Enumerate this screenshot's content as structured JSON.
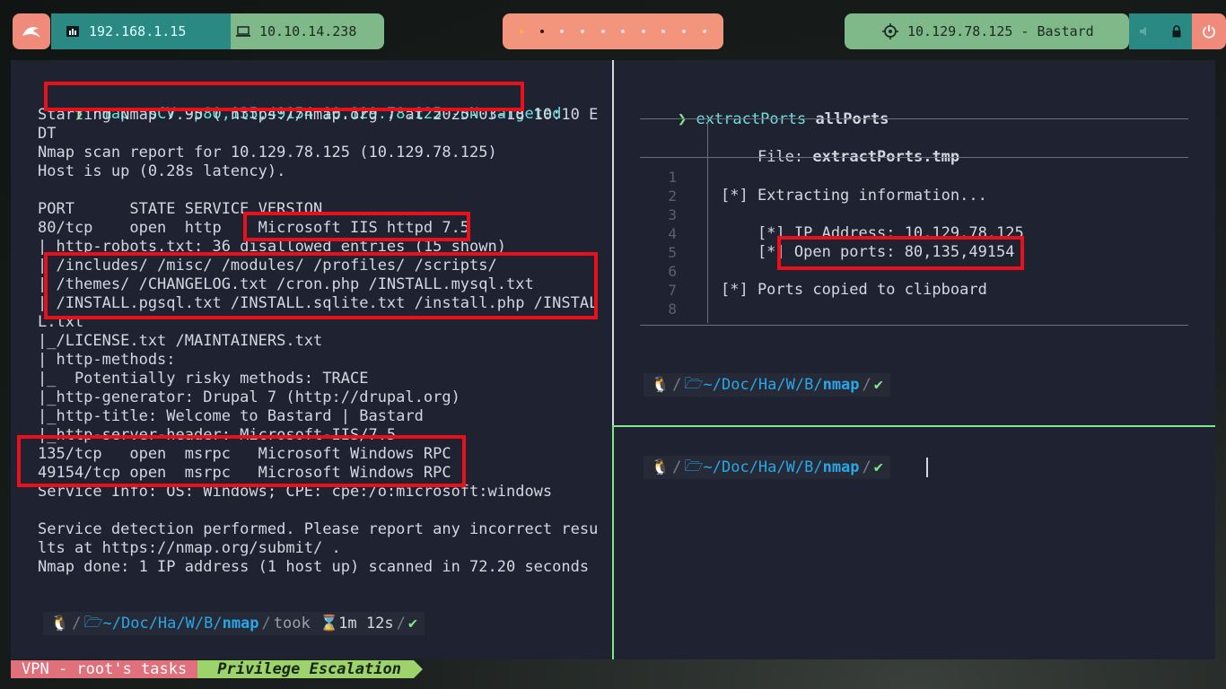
{
  "topbar": {
    "ip_local": "192.168.1.15",
    "ip_vpn": "10.10.14.238",
    "target": "10.129.78.125 - Bastard"
  },
  "left_pane": {
    "prompt_char": "❯",
    "command": "nmap -sCV -p80,135,49154 10.129.78.125 -oN targeted",
    "output": [
      "Starting Nmap 7.95 ( https://nmap.org ) at 2025-03-18 10:10 E",
      "DT",
      "Nmap scan report for 10.129.78.125 (10.129.78.125)",
      "Host is up (0.28s latency).",
      "",
      "PORT      STATE SERVICE VERSION",
      "80/tcp    open  http    Microsoft IIS httpd 7.5",
      "| http-robots.txt: 36 disallowed entries (15 shown)",
      "| /includes/ /misc/ /modules/ /profiles/ /scripts/",
      "| /themes/ /CHANGELOG.txt /cron.php /INSTALL.mysql.txt",
      "| /INSTALL.pgsql.txt /INSTALL.sqlite.txt /install.php /INSTAL",
      "L.txt",
      "|_/LICENSE.txt /MAINTAINERS.txt",
      "| http-methods:",
      "|_  Potentially risky methods: TRACE",
      "|_http-generator: Drupal 7 (http://drupal.org)",
      "|_http-title: Welcome to Bastard | Bastard",
      "|_http-server-header: Microsoft-IIS/7.5",
      "135/tcp   open  msrpc   Microsoft Windows RPC",
      "49154/tcp open  msrpc   Microsoft Windows RPC",
      "Service Info: OS: Windows; CPE: cpe:/o:microsoft:windows",
      "",
      "Service detection performed. Please report any incorrect resu",
      "lts at https://nmap.org/submit/ .",
      "Nmap done: 1 IP address (1 host up) scanned in 72.20 seconds"
    ],
    "prompt": {
      "path_prefix": "~/Doc/Ha/W/B/",
      "path_current": "nmap",
      "took_label": "took",
      "took_value": "1m 12s",
      "status": "✔"
    }
  },
  "right_top": {
    "prompt_char": "❯",
    "command": "extractPorts",
    "argument": "allPorts",
    "file_label": "File:",
    "file_name": "extractPorts.tmp",
    "line_numbers": [
      "1",
      "2",
      "3",
      "4",
      "5",
      "6",
      "7",
      "8"
    ],
    "lines": [
      "",
      "[*] Extracting information...",
      "",
      "    [*] IP Address: 10.129.78.125",
      "    [*] Open ports: 80,135,49154",
      "",
      "[*] Ports copied to clipboard",
      ""
    ],
    "prompt": {
      "path_prefix": "~/Doc/Ha/W/B/",
      "path_current": "nmap",
      "status": "✔"
    }
  },
  "right_bottom": {
    "prompt": {
      "path_prefix": "~/Doc/Ha/W/B/",
      "path_current": "nmap",
      "status": "✔"
    }
  },
  "statusbar": {
    "session": "VPN - root's tasks",
    "task": "Privilege Escalation"
  },
  "colors": {
    "highlight_box": "#e8111b",
    "terminal_bg": "#1f2230",
    "accent_cyan": "#29a6e8",
    "ok_green": "#7ee787"
  }
}
